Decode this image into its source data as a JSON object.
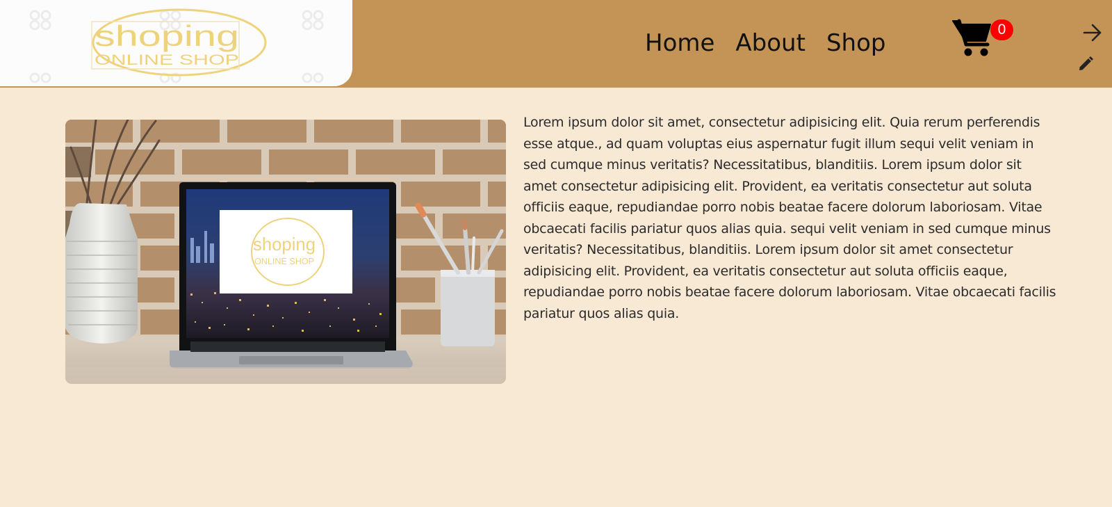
{
  "brand": {
    "logo_line1": "shoping",
    "logo_line2": "ONLINE SHOP",
    "logo_color": "#efd27c"
  },
  "nav": {
    "items": [
      {
        "label": "Home"
      },
      {
        "label": "About"
      },
      {
        "label": "Shop"
      }
    ]
  },
  "cart": {
    "count": "0",
    "icon": "shopping-cart-icon",
    "badge_color": "#ff0000"
  },
  "header_actions": {
    "logout_icon": "arrow-right-icon",
    "edit_icon": "pencil-icon"
  },
  "hero": {
    "screen_logo_line1": "shoping",
    "screen_logo_line2": "ONLINE SHOP"
  },
  "content": {
    "paragraph": "Lorem ipsum dolor sit amet, consectetur adipisicing elit. Quia rerum perferendis esse atque., ad quam voluptas eius aspernatur fugit illum sequi velit veniam in sed cumque minus veritatis? Necessitatibus, blanditiis. Lorem ipsum dolor sit amet consectetur adipisicing elit. Provident, ea veritatis consectetur aut soluta officiis eaque, repudiandae porro nobis beatae facere dolorum laboriosam. Vitae obcaecati facilis pariatur quos alias quia. sequi velit veniam in sed cumque minus veritatis? Necessitatibus, blanditiis. Lorem ipsum dolor sit amet consectetur adipisicing elit. Provident, ea veritatis consectetur aut soluta officiis eaque, repudiandae porro nobis beatae facere dolorum laboriosam. Vitae obcaecati facilis pariatur quos alias quia."
  },
  "colors": {
    "header": "#c49456",
    "page_background": "#f8e9d5"
  }
}
